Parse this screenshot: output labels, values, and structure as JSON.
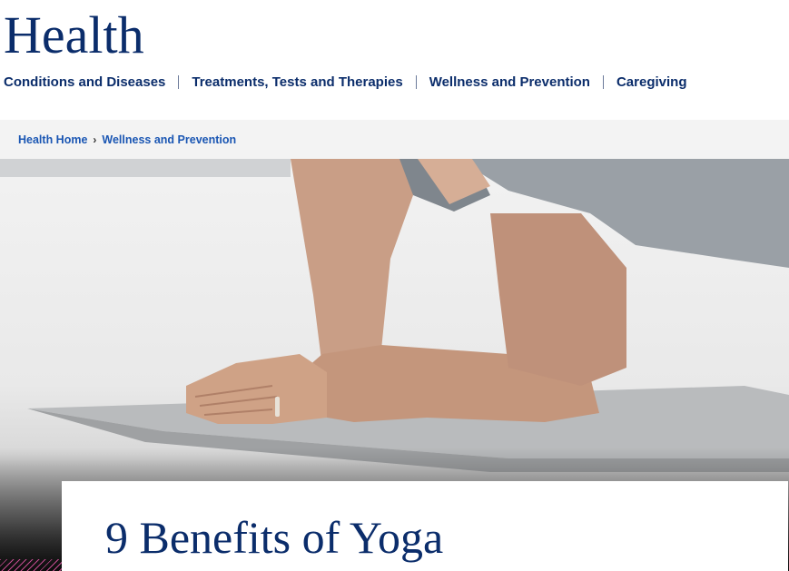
{
  "header": {
    "site_title": "Health"
  },
  "topnav": {
    "items": [
      {
        "label": "Conditions and Diseases"
      },
      {
        "label": "Treatments, Tests and Therapies"
      },
      {
        "label": "Wellness and Prevention"
      },
      {
        "label": "Caregiving"
      }
    ]
  },
  "breadcrumb": {
    "items": [
      {
        "label": "Health Home"
      },
      {
        "label": "Wellness and Prevention"
      }
    ],
    "separator": "›"
  },
  "hero": {
    "image_icon": "yoga-plank-photo"
  },
  "article": {
    "title": "9 Benefits of Yoga"
  },
  "colors": {
    "brand_navy": "#0b2d6b",
    "link_blue": "#1a56b3",
    "accent_magenta": "#c34b8f"
  }
}
